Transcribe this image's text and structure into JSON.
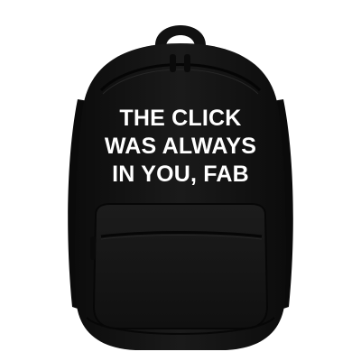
{
  "product": {
    "type": "backpack",
    "body_color": "#141414",
    "print_color": "#ffffff",
    "print_lines": [
      "THE CLICK",
      "WAS ALWAYS",
      "IN YOU, FAB"
    ]
  }
}
